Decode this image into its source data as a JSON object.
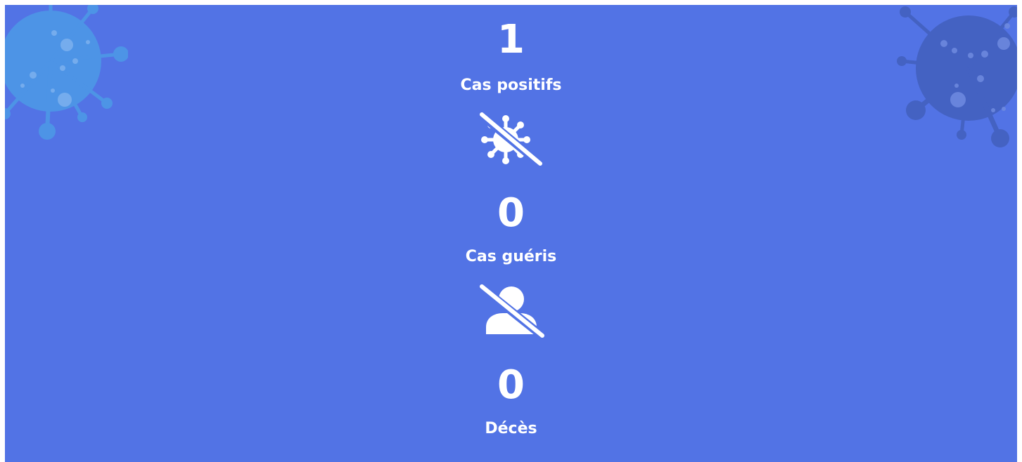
{
  "stats": [
    {
      "value": "1",
      "label": "Cas positifs"
    },
    {
      "value": "0",
      "label": "Cas guéris",
      "icon": "virus-slash-icon"
    },
    {
      "value": "0",
      "label": "Décès",
      "icon": "user-slash-icon"
    }
  ],
  "colors": {
    "background": "#5273e5",
    "text": "#ffffff",
    "virus_left": "#4d94e6",
    "virus_right": "#4462c2"
  }
}
